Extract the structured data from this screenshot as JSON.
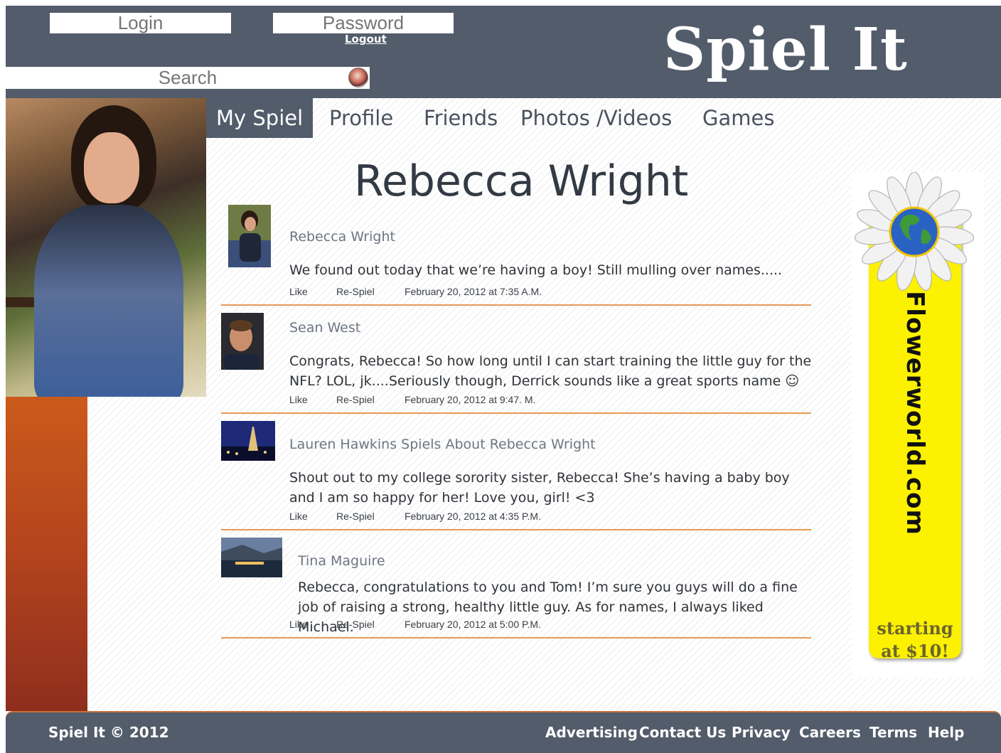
{
  "header": {
    "login_placeholder": "Login",
    "password_placeholder": "Password",
    "logout_label": "Logout",
    "search_placeholder": "Search",
    "logo_text": "Spiel It"
  },
  "tabs": [
    {
      "label": "My Spiel",
      "active": true
    },
    {
      "label": "Profile",
      "active": false
    },
    {
      "label": "Friends",
      "active": false
    },
    {
      "label": "Photos /Videos",
      "active": false
    },
    {
      "label": "Games",
      "active": false
    }
  ],
  "profile": {
    "name": "Rebecca Wright"
  },
  "posts": [
    {
      "author": "Rebecca Wright",
      "text": "We found out today that we’re having a boy! Still mulling over names.....",
      "like": "Like",
      "respiel": "Re-Spiel",
      "timestamp": "February 20, 2012 at 7:35 A.M."
    },
    {
      "author": "Sean West",
      "text": "Congrats, Rebecca! So how long until I can start training the little guy for the NFL? LOL, jk....Seriously though, Derrick sounds like a great sports name ☺",
      "like": "Like",
      "respiel": "Re-Spiel",
      "timestamp": "February 20, 2012 at 9:47. M."
    },
    {
      "author": "Lauren Hawkins Spiels About Rebecca Wright",
      "text": "Shout out to my college sorority sister, Rebecca! She’s having a baby boy and I am so happy for her! Love you, girl! <3",
      "like": "Like",
      "respiel": "Re-Spiel",
      "timestamp": "February 20, 2012 at 4:35 P.M."
    },
    {
      "author": "Tina Maguire",
      "text": "Rebecca, congratulations to you and Tom! I’m sure you guys will do a fine job of raising a strong, healthy little guy. As for names, I always liked Michael.",
      "like": "Like",
      "respiel": "Re-Spiel",
      "timestamp": "February 20, 2012 at 5:00 P.M."
    }
  ],
  "ad": {
    "brand": "Flowerworld.com",
    "price_line1": "starting",
    "price_line2": "at $10!"
  },
  "footer": {
    "copyright": "Spiel It © 2012",
    "links": [
      "Advertising",
      "Contact Us",
      "Privacy",
      "Careers",
      "Terms",
      "Help"
    ]
  },
  "colors": {
    "header_bg": "#525c6a",
    "sidebar_orange": "#e97114",
    "post_divider": "#e59a57",
    "ad_yellow": "#fbf100"
  }
}
